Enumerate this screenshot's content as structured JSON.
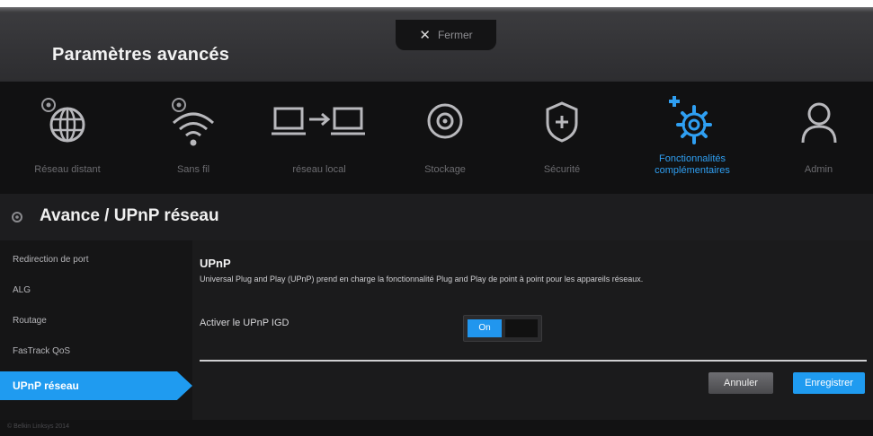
{
  "header": {
    "title": "Paramètres avancés",
    "close_label": "Fermer"
  },
  "nav": {
    "items": [
      {
        "label": "Réseau distant",
        "icon": "globe-icon"
      },
      {
        "label": "Sans fil",
        "icon": "wifi-icon"
      },
      {
        "label": "réseau local",
        "icon": "lan-icon"
      },
      {
        "label": "Stockage",
        "icon": "storage-icon"
      },
      {
        "label": "Sécurité",
        "icon": "shield-icon"
      },
      {
        "label": "Fonctionnalités complémentaires",
        "icon": "gear-icon",
        "active": true
      },
      {
        "label": "Admin",
        "icon": "user-icon"
      }
    ]
  },
  "section": {
    "title": "Avance / UPnP réseau"
  },
  "sidebar": {
    "items": [
      {
        "label": "Redirection de port"
      },
      {
        "label": "ALG"
      },
      {
        "label": "Routage"
      },
      {
        "label": "FasTrack QoS"
      },
      {
        "label": "UPnP réseau",
        "active": true
      }
    ]
  },
  "content": {
    "heading": "UPnP",
    "description": "Universal Plug and Play (UPnP) prend en charge la fonctionnalité Plug and Play de point à point pour les appareils réseaux.",
    "setting_label": "Activer le UPnP IGD",
    "toggle_value": "On"
  },
  "buttons": {
    "cancel_label": "Annuler",
    "save_label": "Enregistrer"
  },
  "footer": {
    "text": "© Belkin Linksys 2014"
  },
  "colors": {
    "accent": "#1f9bf0",
    "background": "#1b1b1c"
  }
}
